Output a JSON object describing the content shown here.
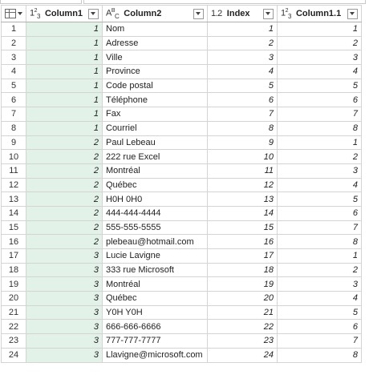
{
  "columns": [
    {
      "type_icon": "123",
      "name": "Column1"
    },
    {
      "type_icon": "ABC",
      "name": "Column2"
    },
    {
      "type_icon": "1.2",
      "name": "Index"
    },
    {
      "type_icon": "123",
      "name": "Column1.1"
    }
  ],
  "rows": [
    {
      "n": "1",
      "c1": "1",
      "c2": "Nom",
      "idx": "1",
      "c11": "1"
    },
    {
      "n": "2",
      "c1": "1",
      "c2": "Adresse",
      "idx": "2",
      "c11": "2"
    },
    {
      "n": "3",
      "c1": "1",
      "c2": "Ville",
      "idx": "3",
      "c11": "3"
    },
    {
      "n": "4",
      "c1": "1",
      "c2": "Province",
      "idx": "4",
      "c11": "4"
    },
    {
      "n": "5",
      "c1": "1",
      "c2": "Code postal",
      "idx": "5",
      "c11": "5"
    },
    {
      "n": "6",
      "c1": "1",
      "c2": "Téléphone",
      "idx": "6",
      "c11": "6"
    },
    {
      "n": "7",
      "c1": "1",
      "c2": "Fax",
      "idx": "7",
      "c11": "7"
    },
    {
      "n": "8",
      "c1": "1",
      "c2": "Courriel",
      "idx": "8",
      "c11": "8"
    },
    {
      "n": "9",
      "c1": "2",
      "c2": "Paul Lebeau",
      "idx": "9",
      "c11": "1"
    },
    {
      "n": "10",
      "c1": "2",
      "c2": "222 rue Excel",
      "idx": "10",
      "c11": "2"
    },
    {
      "n": "11",
      "c1": "2",
      "c2": "Montréal",
      "idx": "11",
      "c11": "3"
    },
    {
      "n": "12",
      "c1": "2",
      "c2": "Québec",
      "idx": "12",
      "c11": "4"
    },
    {
      "n": "13",
      "c1": "2",
      "c2": "H0H 0H0",
      "idx": "13",
      "c11": "5"
    },
    {
      "n": "14",
      "c1": "2",
      "c2": "444-444-4444",
      "idx": "14",
      "c11": "6"
    },
    {
      "n": "15",
      "c1": "2",
      "c2": "555-555-5555",
      "idx": "15",
      "c11": "7"
    },
    {
      "n": "16",
      "c1": "2",
      "c2": "plebeau@hotmail.com",
      "idx": "16",
      "c11": "8"
    },
    {
      "n": "17",
      "c1": "3",
      "c2": "Lucie Lavigne",
      "idx": "17",
      "c11": "1"
    },
    {
      "n": "18",
      "c1": "3",
      "c2": "333 rue Microsoft",
      "idx": "18",
      "c11": "2"
    },
    {
      "n": "19",
      "c1": "3",
      "c2": "Montréal",
      "idx": "19",
      "c11": "3"
    },
    {
      "n": "20",
      "c1": "3",
      "c2": "Québec",
      "idx": "20",
      "c11": "4"
    },
    {
      "n": "21",
      "c1": "3",
      "c2": "Y0H Y0H",
      "idx": "21",
      "c11": "5"
    },
    {
      "n": "22",
      "c1": "3",
      "c2": "666-666-6666",
      "idx": "22",
      "c11": "6"
    },
    {
      "n": "23",
      "c1": "3",
      "c2": "777-777-7777",
      "idx": "23",
      "c11": "7"
    },
    {
      "n": "24",
      "c1": "3",
      "c2": "Llavigne@microsoft.com",
      "idx": "24",
      "c11": "8"
    }
  ],
  "colors": {
    "selected_column_bg": "#e2f2e8",
    "grid_line": "#d4d4d4"
  }
}
